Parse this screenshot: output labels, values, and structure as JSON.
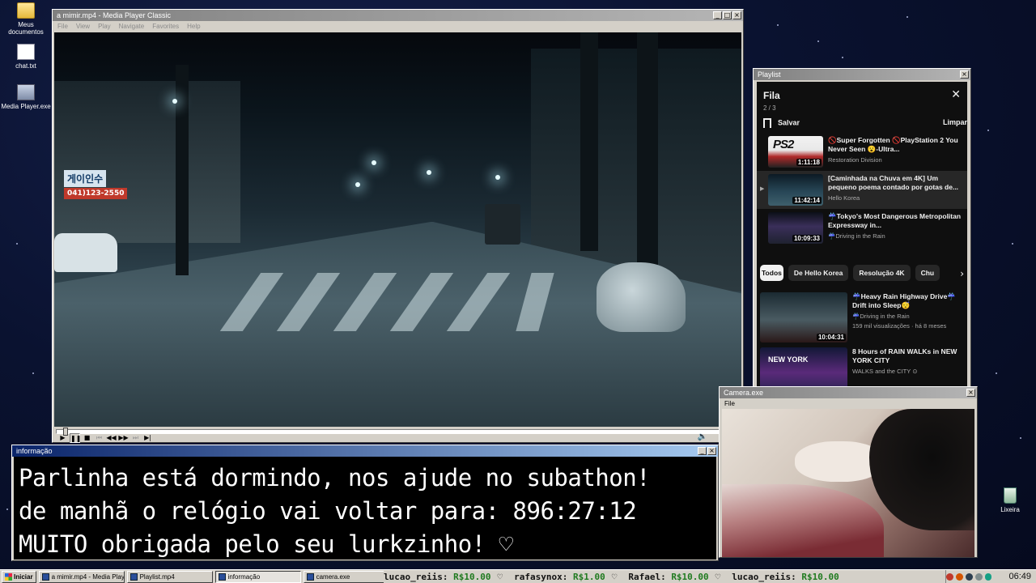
{
  "desktop": {
    "icons": [
      {
        "label": "Meus documentos",
        "icon": "folder-icon"
      },
      {
        "label": "chat.txt",
        "icon": "text-file-icon"
      },
      {
        "label": "Media Player.exe",
        "icon": "exe-icon"
      },
      {
        "label": "Lixeira",
        "icon": "recycle-bin-icon"
      }
    ]
  },
  "mpc": {
    "title": "a mimir.mp4 - Media Player Classic",
    "menu": [
      "File",
      "View",
      "Play",
      "Navigate",
      "Favorites",
      "Help"
    ],
    "video_signs": [
      "게이인수",
      "041)123-2550"
    ],
    "progress": 0.01
  },
  "playlist": {
    "window_title": "Playlist",
    "title": "Fila",
    "count": "2 / 3",
    "save_label": "Salvar",
    "clear_label": "Limpar",
    "queue": [
      {
        "title": "🚫Super Forgotten 🚫PlayStation 2 You Never Seen 😮-Ultra...",
        "channel": "Restoration Division",
        "duration": "1:11:18",
        "thumb_text": "PS2"
      },
      {
        "title": "[Caminhada na Chuva em 4K] Um pequeno poema contado por gotas de...",
        "channel": "Hello Korea",
        "duration": "11:42:14",
        "current_marker": "▶"
      },
      {
        "title": "☔Tokyo's Most Dangerous Metropolitan Expressway in...",
        "channel": "☔Driving in the Rain",
        "duration": "10:09:33"
      }
    ],
    "chips": [
      "Todos",
      "De Hello Korea",
      "Resolução 4K",
      "Chu"
    ],
    "recommended": [
      {
        "title": "☔Heavy Rain Highway Drive☔Drift into Sleep😴",
        "channel": "☔Driving in the Rain",
        "meta": "159 mil visualizações · há 8 meses",
        "duration": "10:04:31"
      },
      {
        "title": "8 Hours of RAIN WALKs in NEW YORK CITY",
        "channel": "WALKS and the CITY ⊙",
        "thumb_text": "NEW YORK"
      }
    ]
  },
  "camera": {
    "title": "Camera.exe",
    "menu": [
      "File"
    ]
  },
  "info": {
    "title": "informação",
    "lines": [
      "Parlinha está dormindo, nos ajude no subathon!",
      "de manhã o relógio vai voltar para:  896:27:12",
      "MUITO obrigada pelo seu lurkzinho! ♡"
    ]
  },
  "taskbar": {
    "start_label": "Iniciar",
    "tasks": [
      {
        "label": "a mimir.mp4 - Media Playe...",
        "active": false
      },
      {
        "label": "Playlist.mp4",
        "active": false
      },
      {
        "label": "informação",
        "active": true
      },
      {
        "label": "camera.exe",
        "active": false
      }
    ],
    "ticker": [
      {
        "user": "lucao_reiis:",
        "amount": "R$10.00"
      },
      {
        "user": "rafasynox:",
        "amount": "R$1.00"
      },
      {
        "user": "Rafael:",
        "amount": "R$10.00"
      },
      {
        "user": "lucao_reiis:",
        "amount": "R$10.00"
      }
    ],
    "ticker_heart": "♡",
    "clock": "06:49"
  }
}
